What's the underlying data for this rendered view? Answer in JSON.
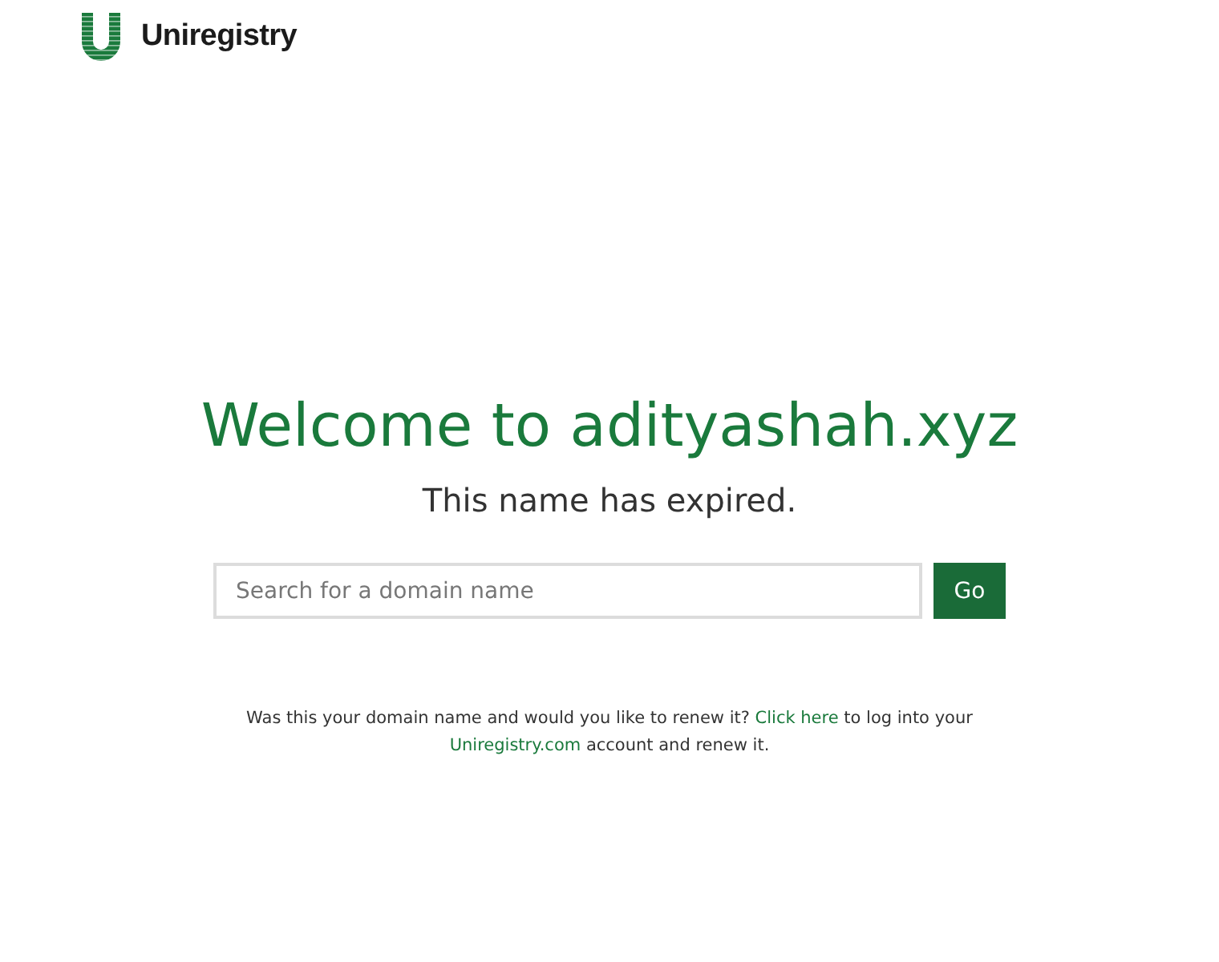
{
  "header": {
    "logo_text": "Uniregistry"
  },
  "title": "Welcome to adityashah.xyz",
  "subtitle": "This name has expired.",
  "search": {
    "placeholder": "Search for a domain name",
    "button": "Go"
  },
  "notice": {
    "before": "Was this your domain name and would you like to renew it? ",
    "link_1": "Click here",
    "middle": " to log into your ",
    "link_2": "Uniregistry.com",
    "after": " account and renew it."
  }
}
